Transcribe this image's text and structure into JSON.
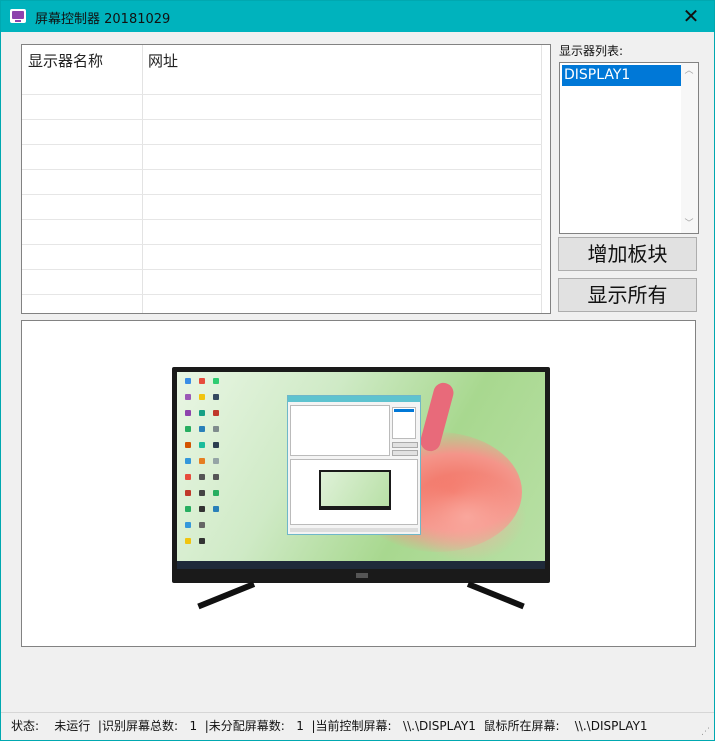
{
  "window": {
    "title": "屏幕控制器 20181029",
    "close_glyph": "✕"
  },
  "grid": {
    "columns": [
      "显示器名称",
      "网址"
    ]
  },
  "display_list": {
    "label": "显示器列表:",
    "items": [
      "DISPLAY1"
    ],
    "selected": "DISPLAY1"
  },
  "buttons": {
    "add_block": "增加板块",
    "show_all": "显示所有"
  },
  "status_bar": {
    "text": "状态:    未运行  |识别屏幕总数:   1  |未分配屏幕数:   1  |当前控制屏幕:   \\\\.\\DISPLAY1  鼠标所在屏幕:    \\\\.\\DISPLAY1"
  },
  "colors": {
    "titlebar": "#00b3bd",
    "selection": "#0078d7"
  }
}
